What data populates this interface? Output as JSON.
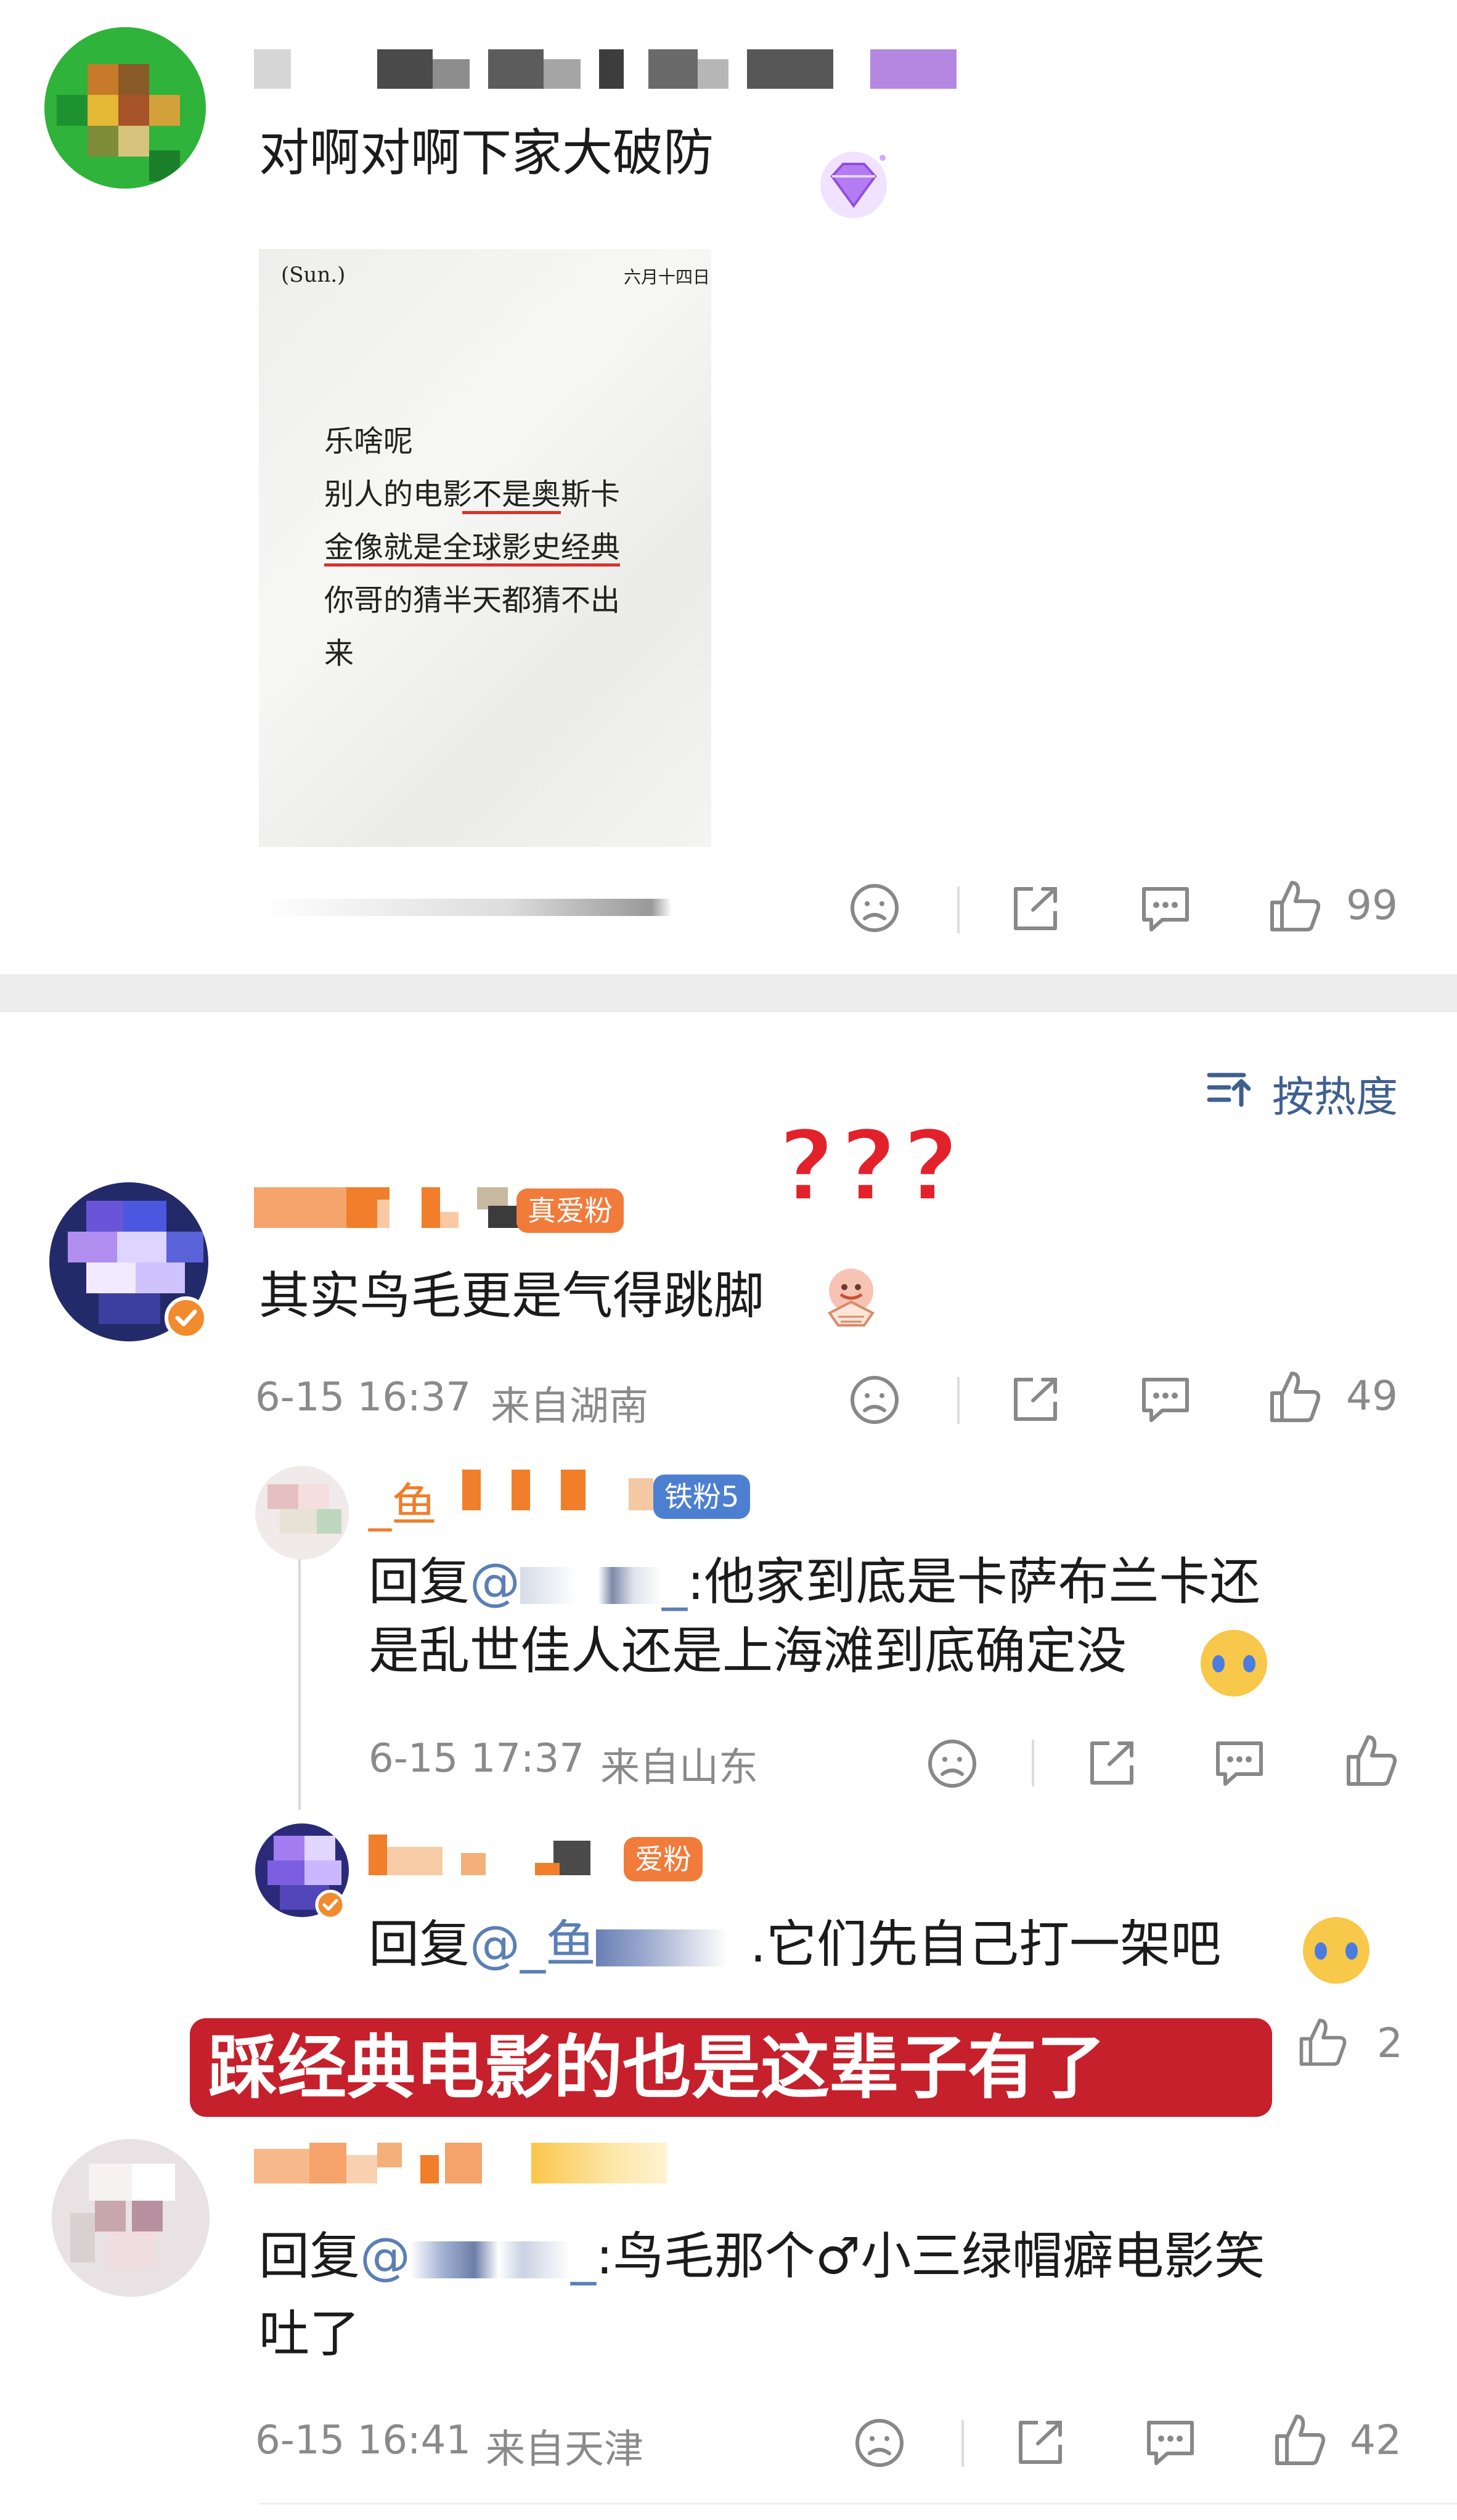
{
  "comment1": {
    "text": "对啊对啊下家大破防",
    "image_card": {
      "header_left": "(Sun.)",
      "header_right": "六月十四日",
      "lines": [
        "乐啥呢",
        "别人的电影不是奥斯卡",
        "金像就是全球影史经典",
        "你哥的猜半天都猜不出",
        "来"
      ]
    },
    "like_count": "99"
  },
  "sort_label": "按热度",
  "annotation_marks": "???",
  "comment2": {
    "badge": "真爱粉",
    "text": "其实鸟毛更是气得跳脚",
    "time": "6-15 16:37",
    "location": "来自湖南",
    "like_count": "49"
  },
  "reply1": {
    "name_visible": "_鱼",
    "badge": "铁粉5",
    "prefix": "回复",
    "mention": "@",
    "mention_tail": "_",
    "line1": ":他家到底是卡萨布兰卡还",
    "line2": "是乱世佳人还是上海滩到底确定没",
    "time": "6-15 17:37",
    "location": "来自山东"
  },
  "reply2": {
    "badge": "爱粉",
    "prefix": "回复",
    "mention": "@_鱼",
    "text": ".它们先自己打一架吧",
    "like_count": "2"
  },
  "caption_banner": "踩经典电影的也是这辈子有了",
  "comment3": {
    "prefix": "回复",
    "mention": "@",
    "mention_tail": "_",
    "line1": ":鸟毛那个♂小三绿帽癖电影笑",
    "line2": "吐了",
    "time": "6-15 16:41",
    "location": "来自天津",
    "like_count": "42"
  },
  "colors": {
    "accent_orange": "#f28a2e",
    "caption_red": "#c5202c",
    "mention_blue": "#5b7fb5",
    "meta_gray": "#8a8a8a"
  }
}
